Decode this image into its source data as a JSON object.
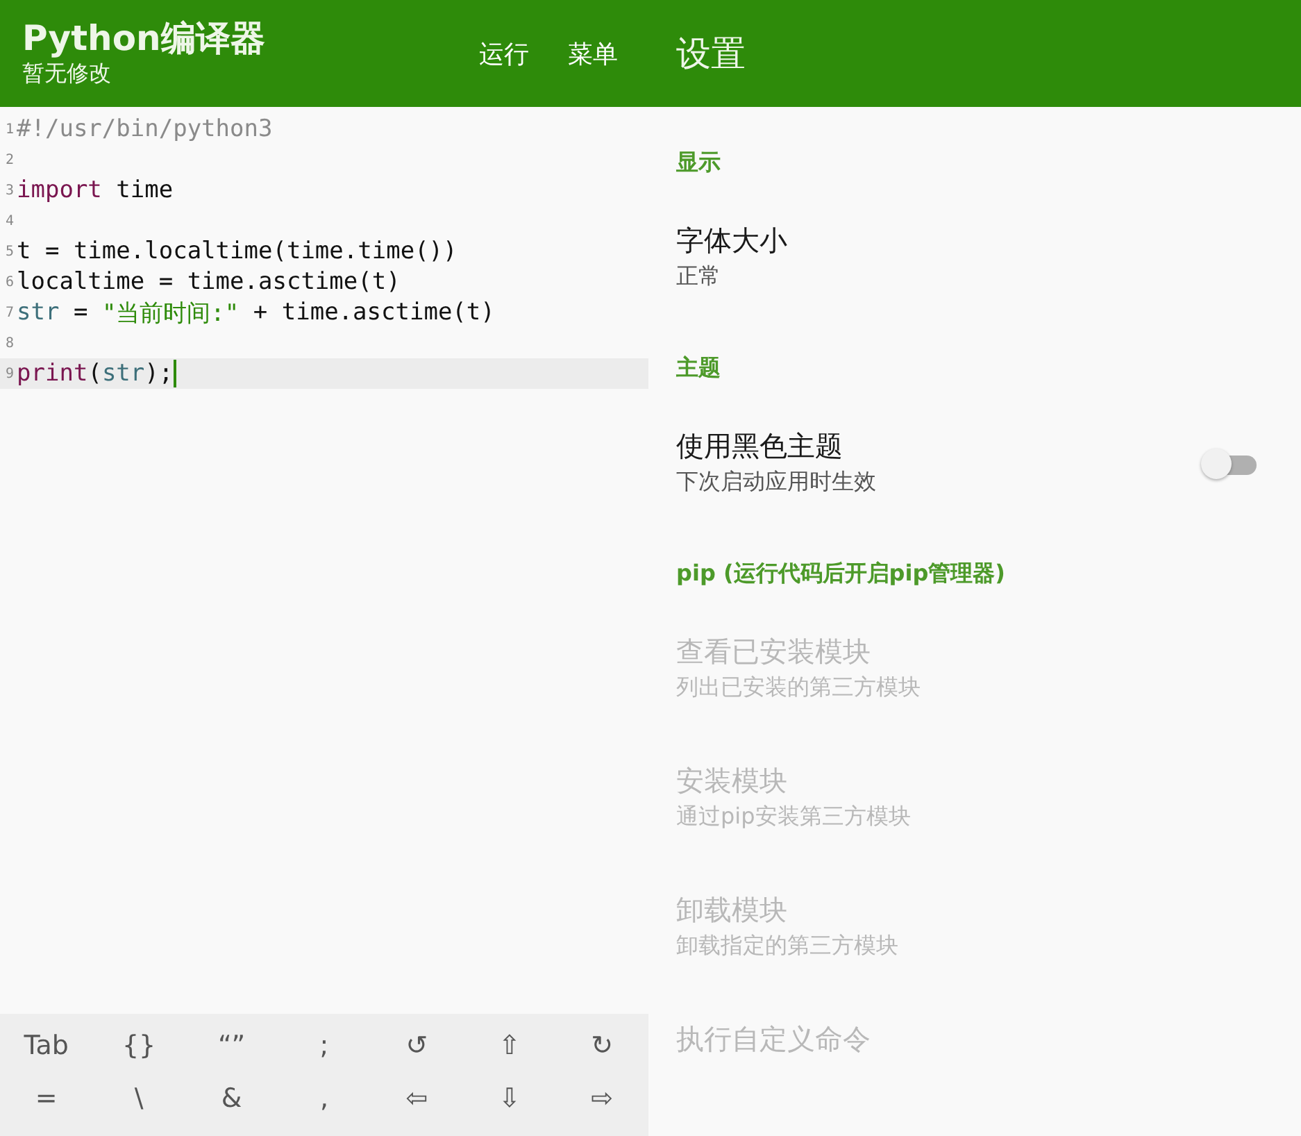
{
  "editor": {
    "title": "Python编译器",
    "subtitle": "暂无修改",
    "actions": [
      "运行",
      "菜单"
    ],
    "lines": [
      {
        "number": "1",
        "current": false,
        "tokens": [
          {
            "text": "#!/usr/bin/python3",
            "kind": "comment"
          }
        ]
      },
      {
        "number": "2",
        "current": false
      },
      {
        "number": "3",
        "current": false,
        "tokens": [
          {
            "text": "import",
            "kind": "keyword"
          },
          {
            "text": " time",
            "kind": "plain"
          }
        ]
      },
      {
        "number": "4",
        "current": false
      },
      {
        "number": "5",
        "current": false,
        "tokens": [
          {
            "text": "t = time.localtime(time.time())",
            "kind": "plain"
          }
        ]
      },
      {
        "number": "6",
        "current": false,
        "tokens": [
          {
            "text": "localtime = time.asctime(t)",
            "kind": "plain"
          }
        ]
      },
      {
        "number": "7",
        "current": false,
        "tokens": [
          {
            "text": "str",
            "kind": "builtin"
          },
          {
            "text": " = ",
            "kind": "plain"
          },
          {
            "text": "\"当前时间:\"",
            "kind": "string"
          },
          {
            "text": " + time.asctime(t)",
            "kind": "plain"
          }
        ]
      },
      {
        "number": "8",
        "current": false
      },
      {
        "number": "9",
        "current": true,
        "tokens": [
          {
            "text": "print",
            "kind": "keyword"
          },
          {
            "text": "(",
            "kind": "plain"
          },
          {
            "text": "str",
            "kind": "builtin"
          },
          {
            "text": ");",
            "kind": "plain"
          }
        ]
      }
    ],
    "keys": [
      [
        "Tab",
        "{}",
        "“”",
        ";",
        "↺",
        "⇧",
        "↻"
      ],
      [
        "=",
        "\\",
        "&",
        ",",
        "⇦",
        "⇩",
        "⇨"
      ]
    ]
  },
  "settings": {
    "title": "设置",
    "items": [
      {
        "kind": "category",
        "title": "显示"
      },
      {
        "kind": "item",
        "title": "字体大小",
        "summary": "正常",
        "disabled": false
      },
      {
        "kind": "category",
        "title": "主题"
      },
      {
        "kind": "switch",
        "title": "使用黑色主题",
        "summary": "下次启动应用时生效",
        "disabled": false,
        "checked": false
      },
      {
        "kind": "category",
        "title": "pip (运行代码后开启pip管理器)"
      },
      {
        "kind": "item",
        "title": "查看已安装模块",
        "summary": "列出已安装的第三方模块",
        "disabled": true
      },
      {
        "kind": "item",
        "title": "安装模块",
        "summary": "通过pip安装第三方模块",
        "disabled": true
      },
      {
        "kind": "item",
        "title": "卸载模块",
        "summary": "卸载指定的第三方模块",
        "disabled": true
      },
      {
        "kind": "item",
        "title": "执行自定义命令",
        "disabled": true
      }
    ]
  }
}
